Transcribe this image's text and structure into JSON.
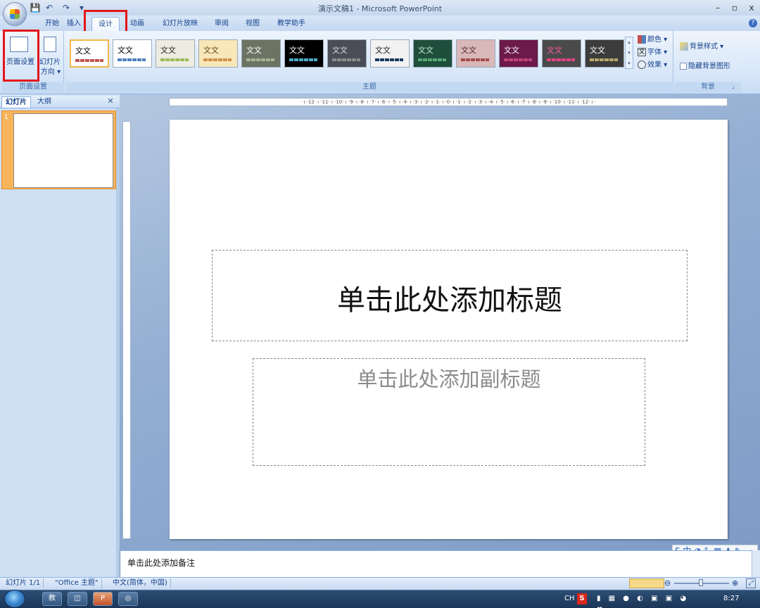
{
  "window": {
    "title": "演示文稿1 - Microsoft PowerPoint",
    "minimize": "–",
    "restore": "▫",
    "close": "x"
  },
  "qat": {
    "save": "💾",
    "undo": "↶",
    "redo": "↷",
    "more": "▾"
  },
  "tabs": [
    "开始",
    "插入",
    "设计",
    "动画",
    "幻灯片放映",
    "审阅",
    "视图",
    "教学助手"
  ],
  "active_tab": "设计",
  "help": "?",
  "ribbon": {
    "page_setup_group": {
      "label": "页面设置",
      "page_setup_btn": "页面设置",
      "orientation_btn_1": "幻灯片",
      "orientation_btn_2": "方向 ▾"
    },
    "themes_group": {
      "label": "主题",
      "theme_text": "文文",
      "themes": [
        {
          "bg": "#ffffff",
          "fg": "#000000",
          "bar": "#c0504d"
        },
        {
          "bg": "#ffffff",
          "fg": "#000000",
          "bar": "#4f81bd"
        },
        {
          "bg": "#eeece1",
          "fg": "#1f1f1f",
          "bar": "#9bbb59"
        },
        {
          "bg": "#f7e7b9",
          "fg": "#6b4a1a",
          "bar": "#d19049"
        },
        {
          "bg": "#6d7363",
          "fg": "#ffffff",
          "bar": "#a5b592"
        },
        {
          "bg": "#000000",
          "fg": "#ffffff",
          "bar": "#4bacc6"
        },
        {
          "bg": "#4a4d57",
          "fg": "#d9d9d9",
          "bar": "#8c8c8c"
        },
        {
          "bg": "#f2f2f2",
          "fg": "#1f1f1f",
          "bar": "#17375e"
        },
        {
          "bg": "#1f4e3d",
          "fg": "#c8e6d0",
          "bar": "#57a773"
        },
        {
          "bg": "#d8b8b8",
          "fg": "#5a2a2a",
          "bar": "#a34b4b"
        },
        {
          "bg": "#6b1a4a",
          "fg": "#ffffff",
          "bar": "#c0447b"
        },
        {
          "bg": "#4a4a4a",
          "fg": "#ff5aa0",
          "bar": "#e24380"
        },
        {
          "bg": "#3c3c3c",
          "fg": "#ffffff",
          "bar": "#b8a96b"
        }
      ],
      "colors_btn": "颜色 ▾",
      "fonts_btn": "字体 ▾",
      "effects_btn": "效果 ▾"
    },
    "background_group": {
      "label": "背景",
      "bg_styles_btn": "背景样式 ▾",
      "hide_bg_checkbox": "隐藏背景图形"
    }
  },
  "panel": {
    "tab_slides": "幻灯片",
    "tab_outline": "大纲",
    "close": "✕",
    "slide_number": "1"
  },
  "ruler": {
    "horizontal": "· ı ·12· ı ·11· ı ·10· ı ·9· ı ·8· ı ·7· ı ·6· ı ·5· ı ·4· ı ·3· ı ·2· ı ·1· ı ·0· ı ·1· ı ·2· ı ·3· ı ·4· ı ·5· ı ·6· ı ·7· ı ·8· ı ·9· ı ·10· ı ·11· ı ·12· ı ·"
  },
  "slide": {
    "title_placeholder": "单击此处添加标题",
    "subtitle_placeholder": "单击此处添加副标题"
  },
  "notes": {
    "placeholder": "单击此处添加备注"
  },
  "ime": {
    "text": "S 中 ◑ °, ▦ ♟ ✎"
  },
  "status": {
    "slide_count": "幻灯片 1/1",
    "theme": "\"Office 主题\"",
    "language": "中文(简体，中国)",
    "zoom_minus": "⊖",
    "zoom_plus": "⊕"
  },
  "taskbar": {
    "apps": [
      "教",
      "◫",
      "P",
      "◎"
    ],
    "lang": "CH",
    "clock": "8:27"
  }
}
